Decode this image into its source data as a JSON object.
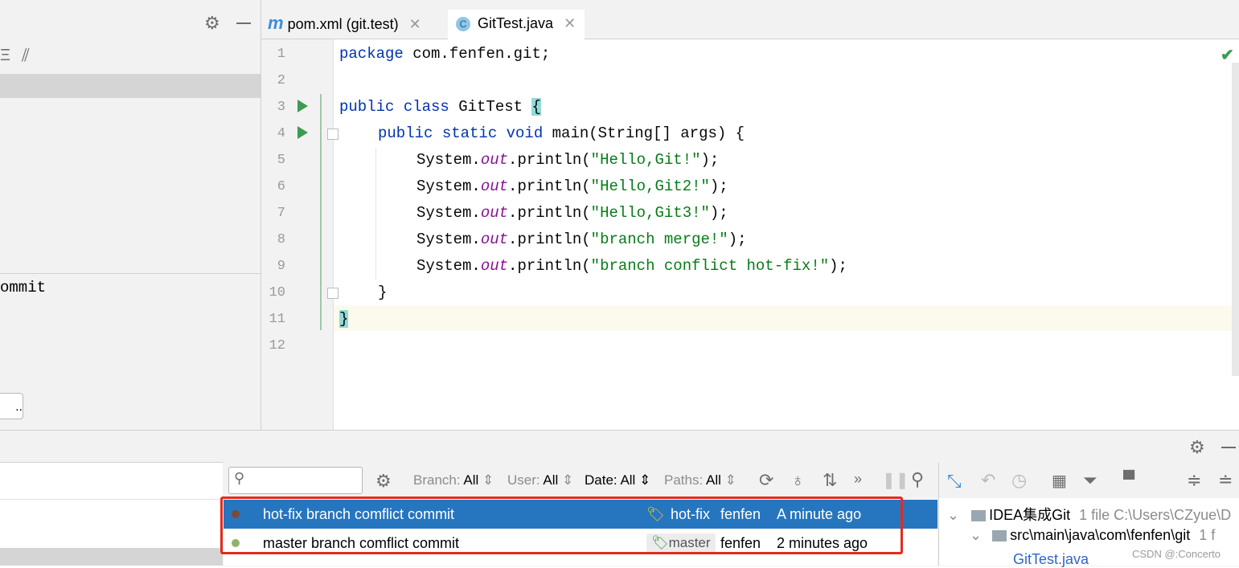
{
  "left_panel": {
    "partial_text": "ommit",
    "button_label": ".."
  },
  "tabs": [
    {
      "label": "pom.xml (git.test)",
      "icon": "maven-icon"
    },
    {
      "label": "GitTest.java",
      "icon": "java-class-icon",
      "active": true
    }
  ],
  "editor": {
    "line_numbers": [
      "1",
      "2",
      "3",
      "4",
      "5",
      "6",
      "7",
      "8",
      "9",
      "10",
      "11",
      "12"
    ],
    "lines": {
      "l1_kw": "package",
      "l1_rest": " com.fenfen.git;",
      "l3_kw": "public class",
      "l3_name": " GitTest ",
      "l3_brace": "{",
      "l4_kw": "public static void",
      "l4_rest": " main(String[] args) {",
      "sys": "System.",
      "out": "out",
      "println": ".println(",
      "s5": "\"Hello,Git!\"",
      "s6": "\"Hello,Git2!\"",
      "s7": "\"Hello,Git3!\"",
      "s8": "\"branch merge!\"",
      "s9": "\"branch conflict hot-fix!\"",
      "end": ");",
      "l10": "}",
      "l11": "}"
    },
    "status": "check-icon"
  },
  "git_log": {
    "filters": {
      "branch_label": "Branch:",
      "branch_value": "All",
      "user_label": "User:",
      "user_value": "All",
      "date_label": "Date:",
      "date_value": "All",
      "paths_label": "Paths:",
      "paths_value": "All"
    },
    "commits": [
      {
        "message": "hot-fix branch comflict commit",
        "branch": "hot-fix",
        "author": "fenfen",
        "time": "A minute ago"
      },
      {
        "message": "master branch comflict commit",
        "branch": "master",
        "author": "fenfen",
        "time": "2 minutes ago"
      }
    ]
  },
  "changes_tree": {
    "root_label": "IDEA集成Git",
    "root_meta": "1 file  C:\\Users\\CZyue\\D",
    "folder_label": "src\\main\\java\\com\\fenfen\\git",
    "folder_meta": "1 f",
    "file_label": "GitTest.java"
  },
  "watermark": "CSDN @:Concerto",
  "colors": {
    "accent": "#2675bf",
    "highlight_box": "#e32b20",
    "keyword": "#0033b3",
    "string": "#067d17"
  }
}
